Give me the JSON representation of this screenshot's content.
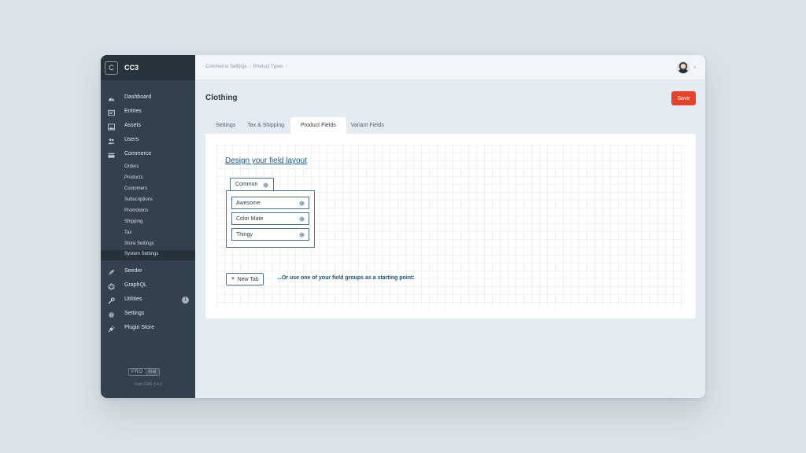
{
  "sidebar": {
    "site_initial": "C",
    "site_name": "CC3",
    "nav": [
      {
        "label": "Dashboard",
        "icon": "gauge-icon"
      },
      {
        "label": "Entries",
        "icon": "entries-icon"
      },
      {
        "label": "Assets",
        "icon": "image-icon"
      },
      {
        "label": "Users",
        "icon": "users-icon"
      },
      {
        "label": "Commerce",
        "icon": "card-icon"
      }
    ],
    "commerce_sub": [
      {
        "label": "Orders"
      },
      {
        "label": "Products"
      },
      {
        "label": "Customers"
      },
      {
        "label": "Subscriptions"
      },
      {
        "label": "Promotions"
      },
      {
        "label": "Shipping"
      },
      {
        "label": "Tax"
      },
      {
        "label": "Store Settings"
      },
      {
        "label": "System Settings"
      }
    ],
    "nav_bottom": [
      {
        "label": "Seeder",
        "icon": "seeder-icon"
      },
      {
        "label": "GraphQL",
        "icon": "graphql-icon"
      },
      {
        "label": "Utilities",
        "icon": "wrench-icon",
        "badge": "1"
      },
      {
        "label": "Settings",
        "icon": "gear-icon"
      },
      {
        "label": "Plugin Store",
        "icon": "plug-icon"
      }
    ],
    "edition_pro": "PRO",
    "edition_trial": "trial",
    "version": "Craft CMS 3.4.9"
  },
  "header": {
    "breadcrumbs": [
      "Commerce Settings",
      "Product Types"
    ]
  },
  "page": {
    "title": "Clothing",
    "save_label": "Save",
    "tabs": [
      {
        "label": "Settings"
      },
      {
        "label": "Tax & Shipping"
      },
      {
        "label": "Product Fields"
      },
      {
        "label": "Variant Fields"
      }
    ]
  },
  "field_layout": {
    "heading": "Design your field layout",
    "tab_name": "Common",
    "fields": [
      {
        "label": "Awesome"
      },
      {
        "label": "Color Mate"
      },
      {
        "label": "Thingy"
      }
    ],
    "new_tab_label": "New Tab",
    "groups_hint": "...Or use one of your field groups as a starting point:"
  },
  "colors": {
    "sidebar_bg": "#33404d",
    "save_button": "#e5422b",
    "link_blue": "#1e5a8a"
  }
}
